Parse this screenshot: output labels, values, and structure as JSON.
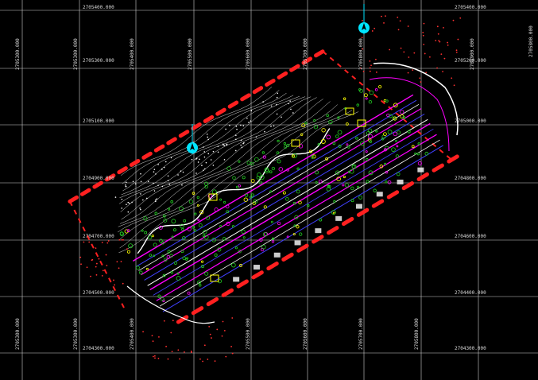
{
  "sheet": {
    "background": "#000000",
    "grid_color": "#d0d0d0",
    "label_color": "#d8d8d8"
  },
  "coordinate_labels": {
    "top_1": "2705400.000",
    "top_2": "2705400.000",
    "row1_left": "2705300.000",
    "row1_right": "2705200.000",
    "row2_left": "2705100.000",
    "row2_right": "2705000.000",
    "row3_left": "2704900.000",
    "row3_right": "2704800.000",
    "row4_left": "2704700.000",
    "row4_right": "2704600.000",
    "row5_left": "2704500.000",
    "row5_right": "2704400.000",
    "bottom_right": "2704300.000",
    "col_1": "2705300.000",
    "col_2": "2705300.000",
    "col_3": "2705400.000",
    "col_4": "2705500.000",
    "col_5": "2705600.000",
    "col_6": "2705700.000",
    "col_7": "2705800.000",
    "col_8": "2705900.000",
    "col_9": "2705800.000",
    "col_b1": "2705300.000",
    "col_b2": "2705400.000",
    "col_b3": "2705500.000",
    "col_b4": "2705600.000",
    "col_b5": "2705700.000",
    "col_b6": "2705800.000"
  },
  "colors": {
    "boundary": "#ff2020",
    "contour": "#ffffff",
    "road_magenta": "#ff00ff",
    "road_blue": "#4040ff",
    "road_white": "#ffffff",
    "vegetation": "#22cc22",
    "yellow": "#ffff00",
    "survey_point": "#ff3030",
    "north_marker": "#00e5ff"
  },
  "markers": {
    "north_marker_count": 2
  }
}
